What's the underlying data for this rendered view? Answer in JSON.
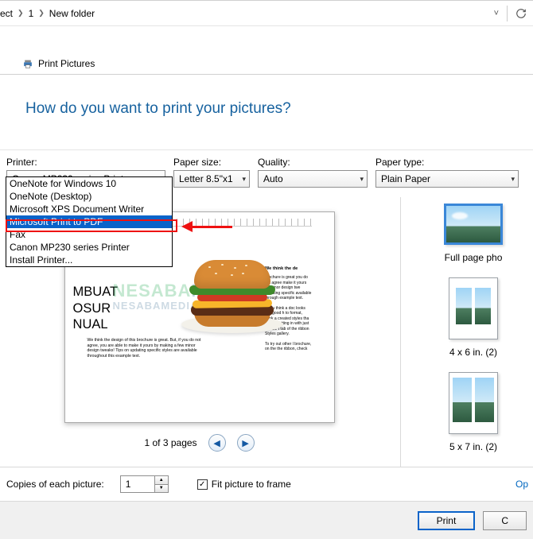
{
  "breadcrumb": {
    "seg1": "ect",
    "seg2": "1",
    "seg3": "New folder"
  },
  "window_title": "Print Pictures",
  "question": "How do you want to print your pictures?",
  "labels": {
    "printer": "Printer:",
    "paper_size": "Paper size:",
    "quality": "Quality:",
    "paper_type": "Paper type:"
  },
  "selects": {
    "printer": "Canon MP230 series Printer",
    "paper_size": "Letter 8.5\"x1",
    "quality": "Auto",
    "paper_type": "Plain Paper"
  },
  "printer_options": [
    "OneNote for Windows 10",
    "OneNote (Desktop)",
    "Microsoft XPS Document Writer",
    "Microsoft Print to PDF",
    "Fax",
    "Canon MP230 series Printer",
    "Install Printer..."
  ],
  "preview": {
    "left_words": {
      "l1": "MBUAT",
      "l2": "OSUR",
      "l3": "NUAL"
    },
    "caption": "We think the design of this brochure is great. But, if you do not agree, you are able to make it yours by making a few minor design tweaks! Tips on updating specific styles are available throughout this example text.",
    "wm1a": "NESABA",
    "wm1b": "MEDIA",
    "wm2": "NESABAMEDIA",
    "right": {
      "h": "We think the de",
      "p1": "brochure is great you do not agree make it yours by minor design twe updating specific available through example text.",
      "p2": "If you think a doc looks this good h to format, think a created styles tha the formatting in with just a click. t tab of the ribbon Styles gallery.",
      "p3": "To try out other l brochure, on the the ribbon, check"
    }
  },
  "pager": {
    "text": "1 of 3 pages"
  },
  "layouts": {
    "l1": "Full page pho",
    "l2": "4 x 6 in. (2)",
    "l3": "5 x 7 in. (2)"
  },
  "footer": {
    "copies_label": "Copies of each picture:",
    "copies_value": "1",
    "fit_label": "Fit picture to frame",
    "options_link": "Op",
    "print": "Print",
    "cancel": "C"
  }
}
